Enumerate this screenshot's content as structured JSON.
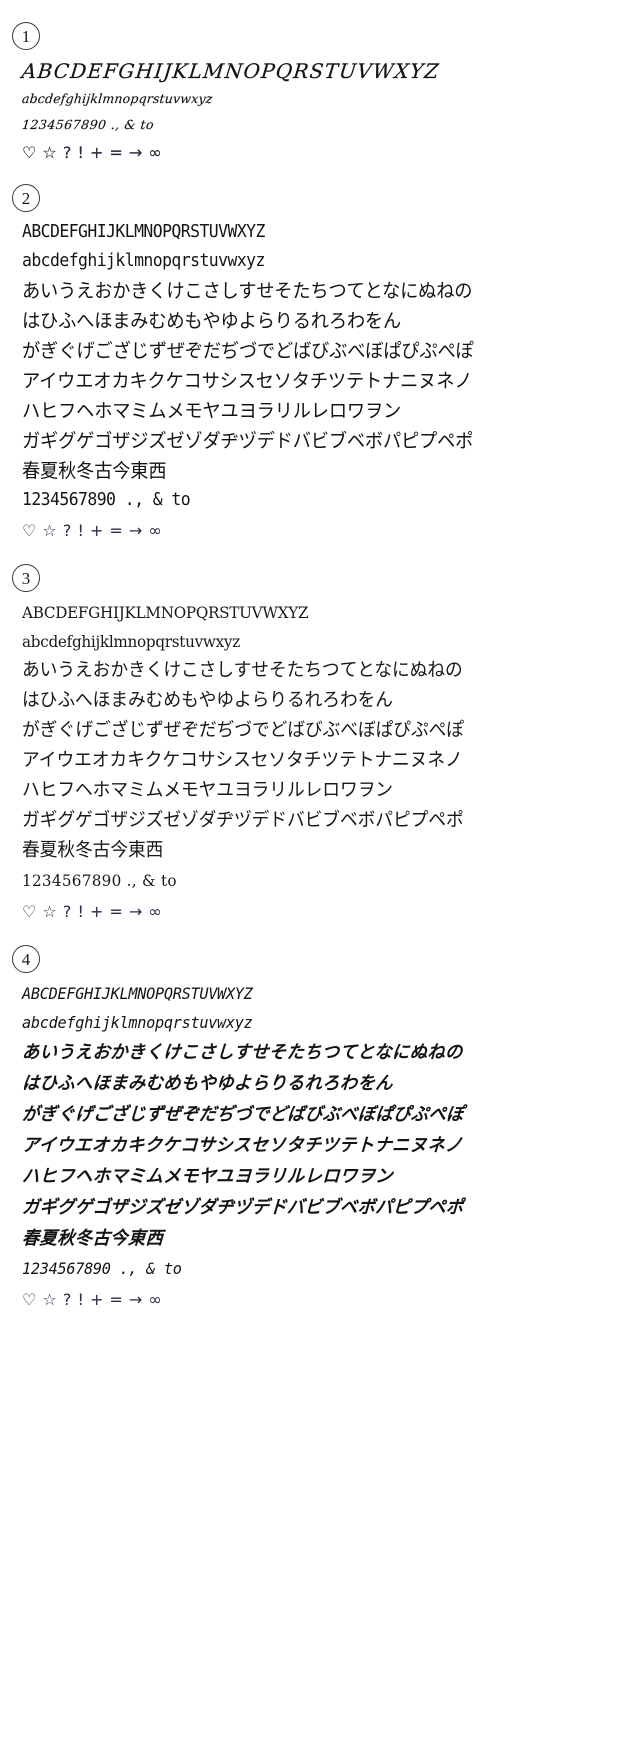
{
  "page": {
    "background_color": "#ffffff",
    "text_color": "#141414",
    "symbol_color": "#2b2b4a"
  },
  "specimens": [
    {
      "marker": "1",
      "style_name": "script",
      "rows": {
        "uppercase": "ABCDEFGHIJKLMNOPQRSTUVWXYZ",
        "lowercase": "abcdefghijklmnopqrstuvwxyz",
        "numerals": "1234567890  .,  & to",
        "symbols": "♡   ☆   ?   !   +   =   →   ∞"
      }
    },
    {
      "marker": "2",
      "style_name": "gothic-sans",
      "rows": {
        "uppercase": "ABCDEFGHIJKLMNOPQRSTUVWXYZ",
        "lowercase": "abcdefghijklmnopqrstuvwxyz",
        "hiragana_1": "あいうえおかきくけこさしすせそたちつてとなにぬねの",
        "hiragana_2": "はひふへほまみむめもやゆよらりるれろわをん",
        "hiragana_dakuten": "がぎぐげござじずぜぞだぢづでどばびぶべぼぱぴぷぺぽ",
        "katakana_1": "アイウエオカキクケコサシスセソタチツテトナニヌネノ",
        "katakana_2": "ハヒフヘホマミムメモヤユヨラリルレロワヲン",
        "katakana_dakuten": "ガギグゲゴザジズゼゾダヂヅデドバビブベボパピプペポ",
        "kanji": "春夏秋冬古今東西",
        "numerals": "1234567890  .,  & to",
        "symbols": "♡   ☆   ?   !   +   =   →   ∞"
      }
    },
    {
      "marker": "3",
      "style_name": "mincho-serif",
      "rows": {
        "uppercase": "ABCDEFGHIJKLMNOPQRSTUVWXYZ",
        "lowercase": "abcdefghijklmnopqrstuvwxyz",
        "hiragana_1": "あいうえおかきくけこさしすせそたちつてとなにぬねの",
        "hiragana_2": "はひふへほまみむめもやゆよらりるれろわをん",
        "hiragana_dakuten": "がぎぐげござじずぜぞだぢづでどばびぶべぼぱぴぷぺぽ",
        "katakana_1": "アイウエオカキクケコサシスセソタチツテトナニヌネノ",
        "katakana_2": "ハヒフヘホマミムメモヤユヨラリルレロワヲン",
        "katakana_dakuten": "ガギグゲゴザジズゼゾダヂヅデドバビブベボパピプペポ",
        "kanji": "春夏秋冬古今東西",
        "numerals": "1234567890  .,  & to",
        "symbols": "♡   ☆   ?   !   +   =   →   ∞"
      }
    },
    {
      "marker": "4",
      "style_name": "italic-brush",
      "rows": {
        "uppercase": "ABCDEFGHIJKLMNOPQRSTUVWXYZ",
        "lowercase": "abcdefghijklmnopqrstuvwxyz",
        "hiragana_1": "あいうえおかきくけこさしすせそたちつてとなにぬねの",
        "hiragana_2": "はひふへほまみむめもやゆよらりるれろわをん",
        "hiragana_dakuten": "がぎぐげござじずぜぞだぢづでどばびぶべぼぱぴぷぺぽ",
        "katakana_1": "アイウエオカキクケコサシスセソタチツテトナニヌネノ",
        "katakana_2": "ハヒフヘホマミムメモヤユヨラリルレロワヲン",
        "katakana_dakuten": "ガギグゲゴザジズゼゾダヂヅデドバビブベボパピプペポ",
        "kanji": "春夏秋冬古今東西",
        "numerals": "1234567890  .,  & to",
        "symbols": "♡   ☆   ?   !   +   =   →   ∞"
      }
    }
  ]
}
